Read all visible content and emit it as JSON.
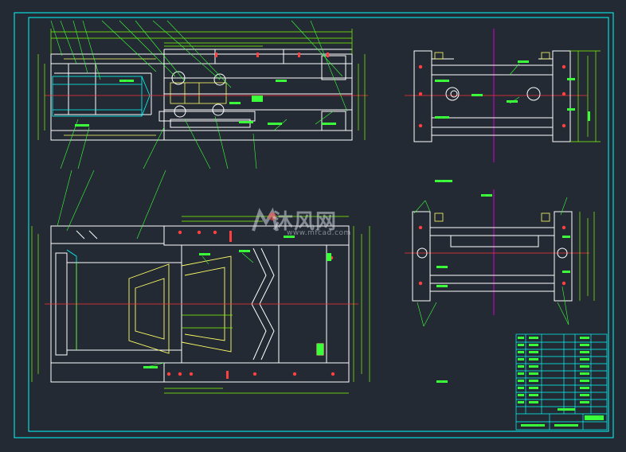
{
  "watermark": {
    "site_name": "沐风网",
    "site_url": "www.mfcad.com"
  },
  "colors": {
    "background": "#232a33",
    "frame": "#00ffff",
    "outline": "#ffffff",
    "dimension": "#7fff00",
    "leader": "#3cff3c",
    "centerline": "#ff3030",
    "axis": "#d000d0",
    "hidden": "#ffff66",
    "hole": "#ff4040"
  },
  "title_block": {
    "rows": 12,
    "cols": 6
  }
}
